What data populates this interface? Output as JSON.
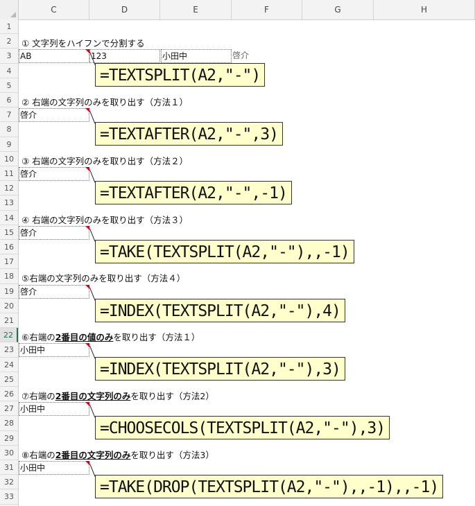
{
  "columns": [
    "C",
    "D",
    "E",
    "F",
    "G",
    "H"
  ],
  "rows": [
    "1",
    "2",
    "3",
    "4",
    "5",
    "6",
    "7",
    "8",
    "9",
    "10",
    "11",
    "12",
    "13",
    "14",
    "15",
    "16",
    "17",
    "18",
    "19",
    "20",
    "21",
    "22",
    "23",
    "24",
    "25",
    "26",
    "27",
    "28",
    "29",
    "30",
    "31",
    "32",
    "33"
  ],
  "active_row": "22",
  "sections": [
    {
      "heading_pre": "① 文字列をハイフンで分割する",
      "heading_bold": "",
      "heading_post": "",
      "cells": [
        "AB",
        "123",
        "小田中",
        "啓介"
      ],
      "formula": "=TEXTSPLIT(A2,\"-\")"
    },
    {
      "heading_pre": "② 右端の文字列のみを取り出す（方法１）",
      "heading_bold": "",
      "heading_post": "",
      "cells": [
        "啓介"
      ],
      "formula": "=TEXTAFTER(A2,\"-\",3)"
    },
    {
      "heading_pre": "③ 右端の文字列のみを取り出す（方法２）",
      "heading_bold": "",
      "heading_post": "",
      "cells": [
        "啓介"
      ],
      "formula": "=TEXTAFTER(A2,\"-\",-1)"
    },
    {
      "heading_pre": "④ 右端の文字列のみを取り出す（方法３）",
      "heading_bold": "",
      "heading_post": "",
      "cells": [
        "啓介"
      ],
      "formula": "=TAKE(TEXTSPLIT(A2,\"-\"),,-1)"
    },
    {
      "heading_pre": "⑤右端の文字列のみを取り出す（方法４）",
      "heading_bold": "",
      "heading_post": "",
      "cells": [
        "啓介"
      ],
      "formula": "=INDEX(TEXTSPLIT(A2,\"-\"),4)"
    },
    {
      "heading_pre": "⑥右端の",
      "heading_bold": "2番目の値のみ",
      "heading_post": "を取り出す（方法１）",
      "cells": [
        "小田中"
      ],
      "formula": "=INDEX(TEXTSPLIT(A2,\"-\"),3)"
    },
    {
      "heading_pre": "⑦右端の",
      "heading_bold": "2番目の文字列のみ",
      "heading_post": "を取り出す（方法2）",
      "cells": [
        "小田中"
      ],
      "formula": "=CHOOSECOLS(TEXTSPLIT(A2,\"-\"),3)"
    },
    {
      "heading_pre": "⑧右端の",
      "heading_bold": "2番目の文字列のみ",
      "heading_post": "を取り出す（方法3）",
      "cells": [
        "小田中"
      ],
      "formula": "=TAKE(DROP(TEXTSPLIT(A2,\"-\"),,-1),,-1)"
    }
  ]
}
